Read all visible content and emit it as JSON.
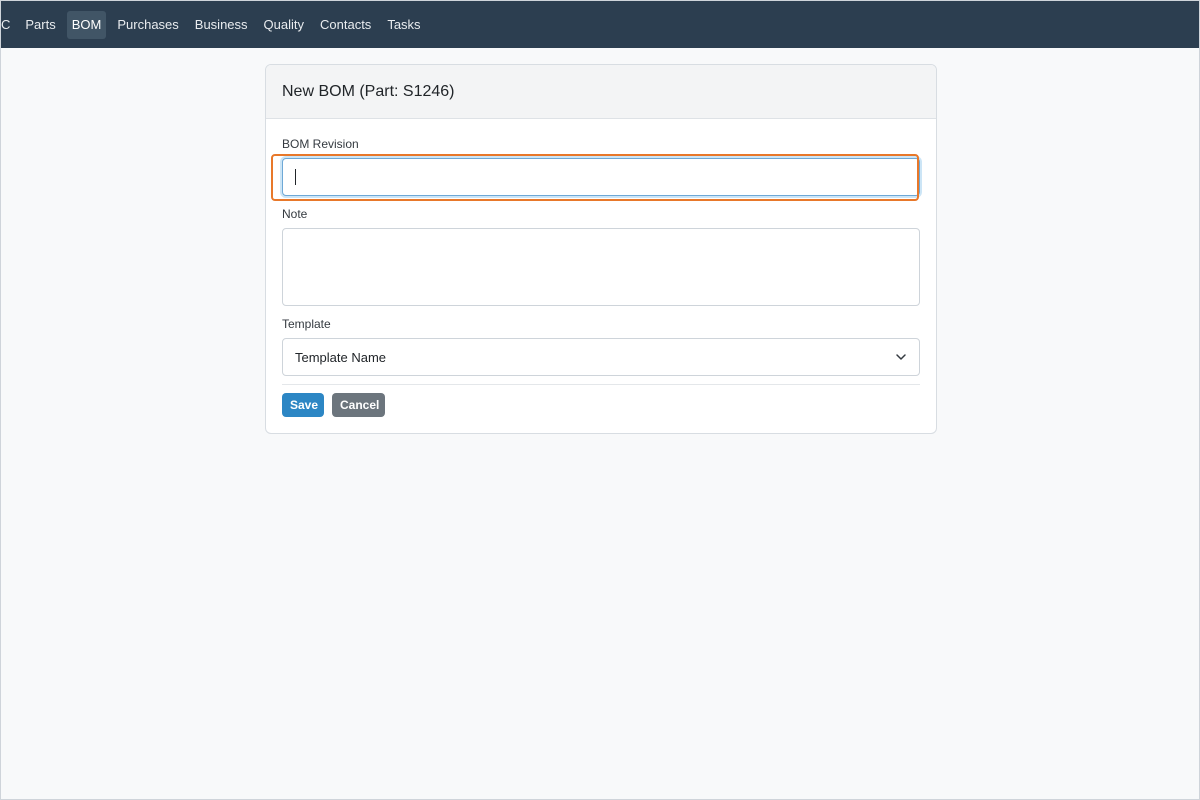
{
  "nav": {
    "items": [
      {
        "label": "C"
      },
      {
        "label": "Parts"
      },
      {
        "label": "BOM"
      },
      {
        "label": "Purchases"
      },
      {
        "label": "Business"
      },
      {
        "label": "Quality"
      },
      {
        "label": "Contacts"
      },
      {
        "label": "Tasks"
      }
    ],
    "active": "BOM"
  },
  "card": {
    "title": "New BOM (Part: S1246)"
  },
  "form": {
    "revision_label": "BOM Revision",
    "revision_value": "",
    "note_label": "Note",
    "note_value": "",
    "template_label": "Template",
    "template_selected": "Template Name",
    "save_label": "Save",
    "cancel_label": "Cancel"
  },
  "colors": {
    "navbar": "#2c3e50",
    "highlight": "#e8782a",
    "save_button": "#2c86c4",
    "cancel_button": "#6c757d"
  },
  "icons": {
    "select_chevron": "chevron-down-icon",
    "textarea_grip": "resize-grip-icon"
  }
}
